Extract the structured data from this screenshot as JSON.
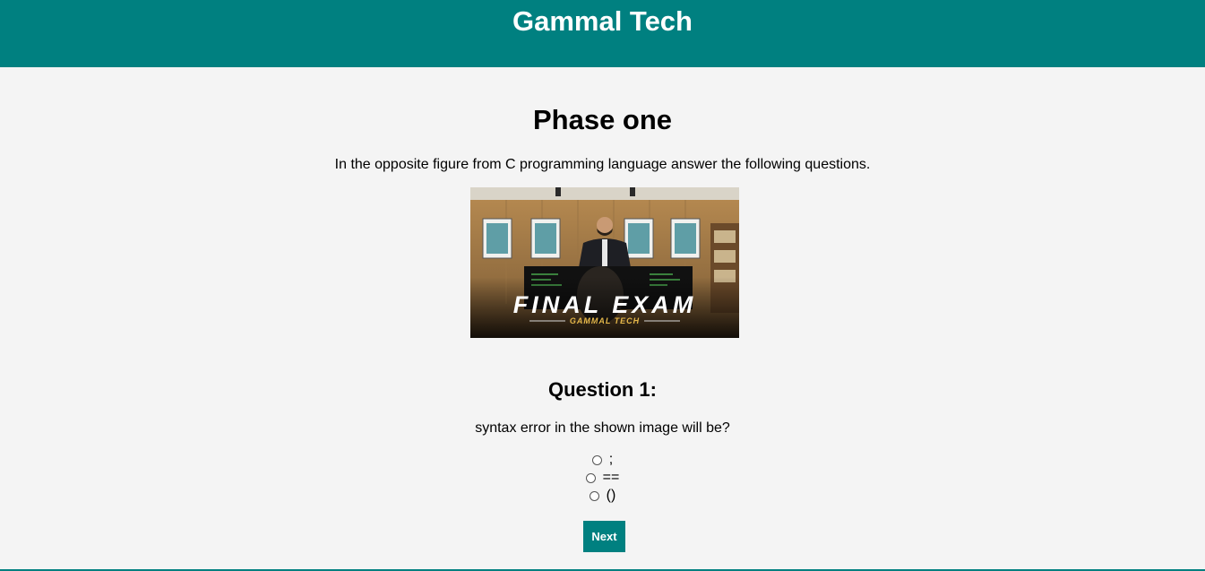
{
  "header": {
    "title": "Gammal Tech"
  },
  "phase": {
    "title": "Phase one",
    "instructions": "In the opposite figure from C programming language answer the following questions."
  },
  "figure": {
    "banner_title": "FINAL EXAM",
    "banner_subtitle": "GAMMAL TECH"
  },
  "question": {
    "title": "Question 1:",
    "text": "syntax error in the shown image will be?",
    "options": [
      ";",
      "==",
      "()"
    ]
  },
  "actions": {
    "next_label": "Next"
  },
  "colors": {
    "brand": "#008080",
    "background": "#f4f4f4"
  }
}
